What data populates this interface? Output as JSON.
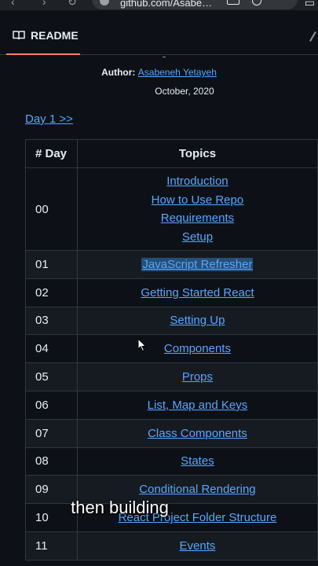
{
  "browser": {
    "url": "github.com/Asabe…",
    "nav_back": "‹",
    "nav_forward": "›",
    "nav_reload": "↻"
  },
  "readme": {
    "tab_label": "README"
  },
  "doc": {
    "author_label": "Author:",
    "author_name": "Asabeneh Yetayeh",
    "date": "October, 2020",
    "day1_link": "Day 1 >>"
  },
  "table": {
    "headers": {
      "day": "# Day",
      "topics": "Topics"
    },
    "first_row": {
      "day": "00",
      "topics": [
        "Introduction",
        "How to Use Repo",
        "Requirements",
        "Setup"
      ]
    },
    "rows": [
      {
        "day": "01",
        "topic": "JavaScript Refresher"
      },
      {
        "day": "02",
        "topic": "Getting Started React"
      },
      {
        "day": "03",
        "topic": "Setting Up"
      },
      {
        "day": "04",
        "topic": "Components"
      },
      {
        "day": "05",
        "topic": "Props"
      },
      {
        "day": "06",
        "topic": "List, Map and Keys"
      },
      {
        "day": "07",
        "topic": "Class Components"
      },
      {
        "day": "08",
        "topic": "States"
      },
      {
        "day": "09",
        "topic": "Conditional Rendering"
      },
      {
        "day": "10",
        "topic": "React Project Folder Structure"
      },
      {
        "day": "11",
        "topic": "Events"
      }
    ]
  },
  "caption": "then building",
  "colors": {
    "background": "#0d1117",
    "link": "#58a6ff",
    "accent_underline": "#f78166",
    "selection": "#264f78"
  }
}
